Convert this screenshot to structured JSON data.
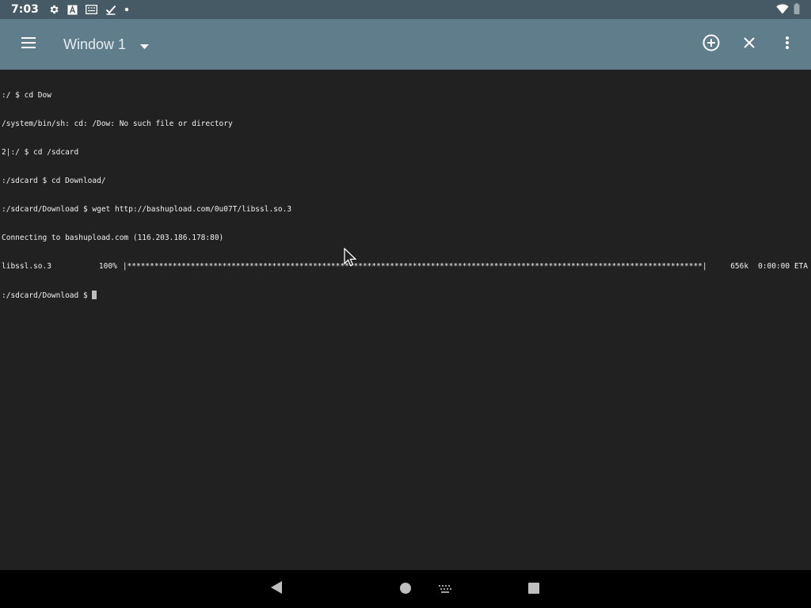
{
  "status_bar": {
    "time": "7:03",
    "icons": [
      "settings-icon",
      "text-a-icon",
      "keyboard-badge-icon",
      "check-icon",
      "dot-icon"
    ],
    "right_icons": [
      "wifi-icon",
      "battery-icon"
    ]
  },
  "app_bar": {
    "menu_icon": "hamburger-menu-icon",
    "window_title": "Window 1",
    "dropdown_icon": "dropdown-arrow-icon",
    "actions": [
      "add-window-icon",
      "close-window-icon",
      "more-options-icon"
    ],
    "background_color": "#607d8b"
  },
  "terminal": {
    "lines": [
      ":/ $ cd Dow",
      "/system/bin/sh: cd: /Dow: No such file or directory",
      "2|:/ $ cd /sdcard",
      ":/sdcard $ cd Download/",
      ":/sdcard/Download $ wget http://bashupload.com/0u07T/libssl.so.3",
      "Connecting to bashupload.com (116.203.186.178:80)"
    ],
    "progress": {
      "filename": "libssl.so.3",
      "percent": "100%",
      "bar": "|*******************************************************************************************************************************|",
      "size": "656k",
      "eta": "0:00:00 ETA"
    },
    "prompt": ":/sdcard/Download $ ",
    "background_color": "#212121"
  },
  "nav_bar": {
    "buttons": [
      "back-icon",
      "home-icon",
      "keyboard-icon",
      "recents-icon"
    ]
  }
}
